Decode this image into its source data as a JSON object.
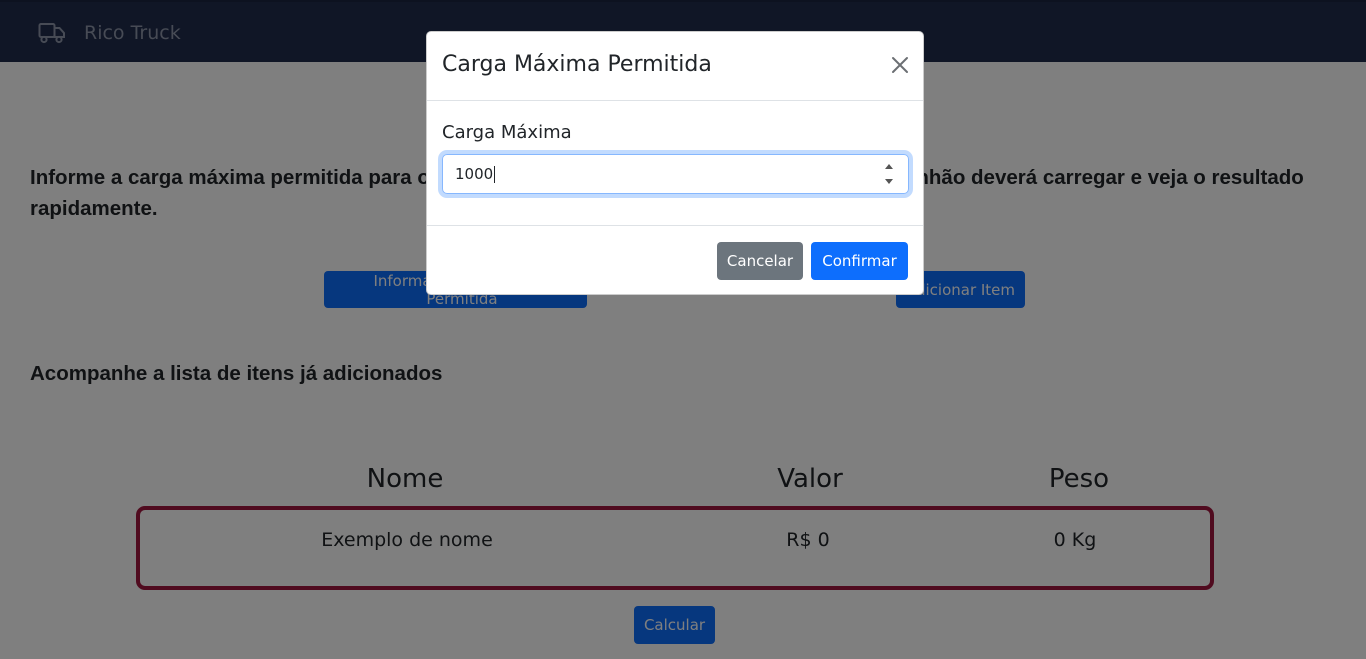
{
  "navbar": {
    "brand": "Rico Truck",
    "brand_icon": "truck-icon"
  },
  "page": {
    "intro": "Informe a carga máxima permitida para o caminhão, adicione os itens e valores que o caminhão deverá carregar e veja o resultado rapidamente.",
    "informar_button": "Informar Carga Máxima Permitida",
    "adicionar_button": "Adicionar Item",
    "list_title": "Acompanhe a lista de itens já adicionados",
    "calcular_button": "Calcular"
  },
  "table": {
    "headers": [
      "Nome",
      "Valor",
      "Peso"
    ],
    "rows": [
      {
        "nome": "Exemplo de nome",
        "valor": "R$ 0",
        "peso": "0 Kg"
      }
    ]
  },
  "modal": {
    "title": "Carga Máxima Permitida",
    "field_label": "Carga Máxima",
    "field_value": "1000",
    "cancel": "Cancelar",
    "confirm": "Confirmar"
  },
  "colors": {
    "navbar": "#212d4d",
    "primary": "#0d6efd",
    "secondary": "#6c757d",
    "row_border": "#a0173f"
  }
}
